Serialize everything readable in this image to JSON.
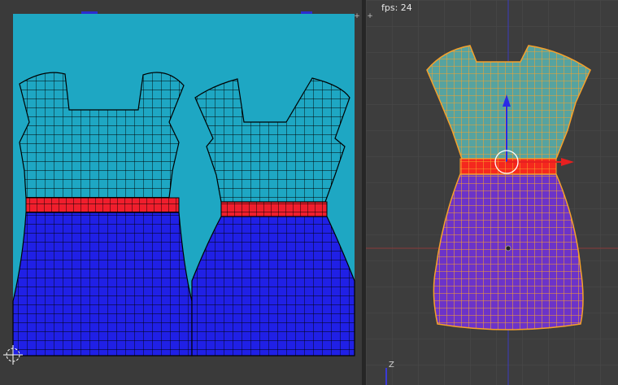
{
  "viewport": {
    "fps_label": "fps: 24",
    "axis_z": "Z"
  },
  "colors": {
    "uv_background": "#1ea7c3",
    "editor_background": "#3a3a3a",
    "mesh_top": "#56a3a0",
    "mesh_waist": "#f5281e",
    "mesh_skirt": "#6c33c9",
    "wire_orange": "#f7a12a",
    "uv_skirt": "#2020e6",
    "uv_waist": "#f01e2d",
    "manipulator_blue": "#2a2ae6",
    "manipulator_red": "#e62020"
  },
  "icons": {
    "split": "plus-icon",
    "axis_gizmo": "axis-gizmo-icon",
    "uv_2d_cursor": "crosshair-icon"
  }
}
